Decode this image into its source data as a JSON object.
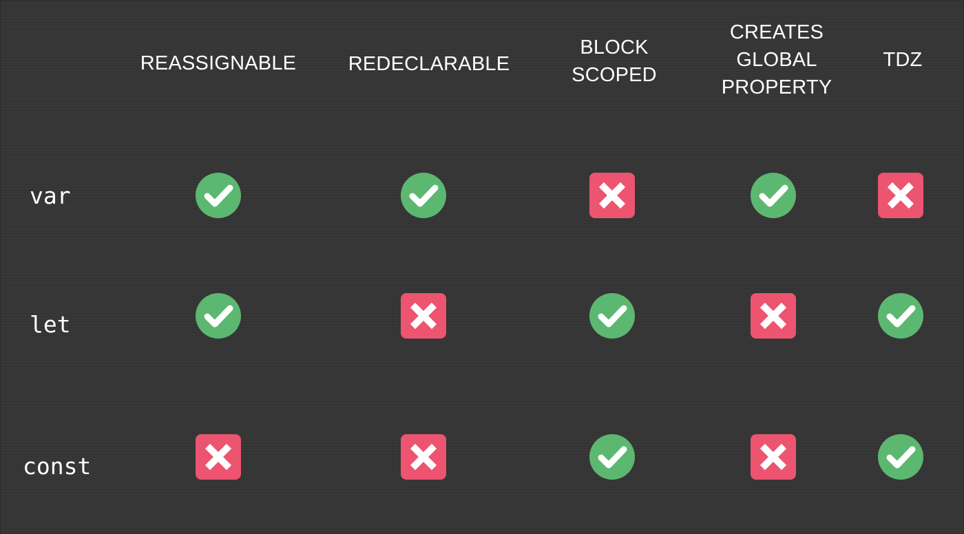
{
  "columns": [
    {
      "label": "REASSIGNABLE"
    },
    {
      "label": "REDECLARABLE"
    },
    {
      "label": "BLOCK\nSCOPED"
    },
    {
      "label": "CREATES\nGLOBAL\nPROPERTY"
    },
    {
      "label": "TDZ"
    }
  ],
  "rows": [
    {
      "label": "var",
      "values": [
        true,
        true,
        false,
        true,
        false
      ]
    },
    {
      "label": "let",
      "values": [
        true,
        false,
        true,
        false,
        true
      ]
    },
    {
      "label": "const",
      "values": [
        false,
        false,
        true,
        false,
        true
      ]
    }
  ],
  "icons": {
    "yes": "check-icon",
    "no": "cross-icon"
  },
  "colors": {
    "background": "#363636",
    "check": "#5cb870",
    "cross": "#ec5470",
    "text": "#ffffff"
  }
}
